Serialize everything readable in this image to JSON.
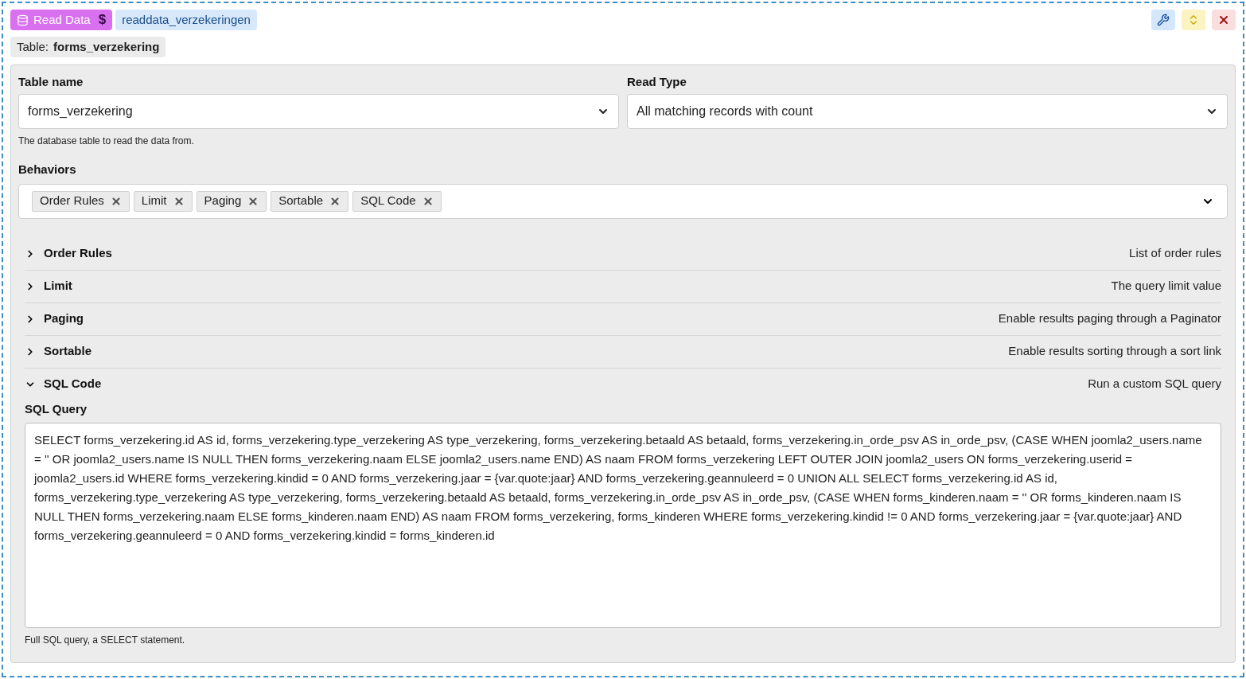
{
  "header": {
    "badge": "Read Data",
    "badge_symbol": "$",
    "name": "readdata_verzekeringen",
    "table_label": "Table:",
    "table_value": "forms_verzekering"
  },
  "fields": [
    {
      "label": "Table name",
      "value": "forms_verzekering",
      "help": "The database table to read the data from."
    },
    {
      "label": "Read Type",
      "value": "All matching records with count"
    }
  ],
  "behaviors": {
    "label": "Behaviors",
    "tags": [
      "Order Rules",
      "Limit",
      "Paging",
      "Sortable",
      "SQL Code"
    ]
  },
  "sections": [
    {
      "title": "Order Rules",
      "description": "List of order rules",
      "expanded": false
    },
    {
      "title": "Limit",
      "description": "The query limit value",
      "expanded": false
    },
    {
      "title": "Paging",
      "description": "Enable results paging through a Paginator",
      "expanded": false
    },
    {
      "title": "Sortable",
      "description": "Enable results sorting through a sort link",
      "expanded": false
    },
    {
      "title": "SQL Code",
      "description": "Run a custom SQL query",
      "expanded": true,
      "field": {
        "label": "SQL Query",
        "value": "SELECT forms_verzekering.id AS id, forms_verzekering.type_verzekering AS type_verzekering, forms_verzekering.betaald AS betaald, forms_verzekering.in_orde_psv AS in_orde_psv, (CASE WHEN joomla2_users.name = '' OR joomla2_users.name IS NULL THEN forms_verzekering.naam ELSE joomla2_users.name END) AS naam FROM forms_verzekering LEFT OUTER JOIN joomla2_users ON forms_verzekering.userid = joomla2_users.id WHERE forms_verzekering.kindid = 0 AND forms_verzekering.jaar = {var.quote:jaar} AND forms_verzekering.geannuleerd = 0 UNION ALL SELECT forms_verzekering.id AS id, forms_verzekering.type_verzekering AS type_verzekering, forms_verzekering.betaald AS betaald, forms_verzekering.in_orde_psv AS in_orde_psv, (CASE WHEN forms_kinderen.naam = '' OR forms_kinderen.naam IS NULL THEN forms_verzekering.naam ELSE forms_kinderen.naam END) AS naam FROM forms_verzekering, forms_kinderen WHERE forms_verzekering.kindid != 0 AND forms_verzekering.jaar = {var.quote:jaar} AND forms_verzekering.geannuleerd = 0 AND forms_verzekering.kindid = forms_kinderen.id",
        "help": "Full SQL query, a SELECT statement."
      }
    }
  ]
}
